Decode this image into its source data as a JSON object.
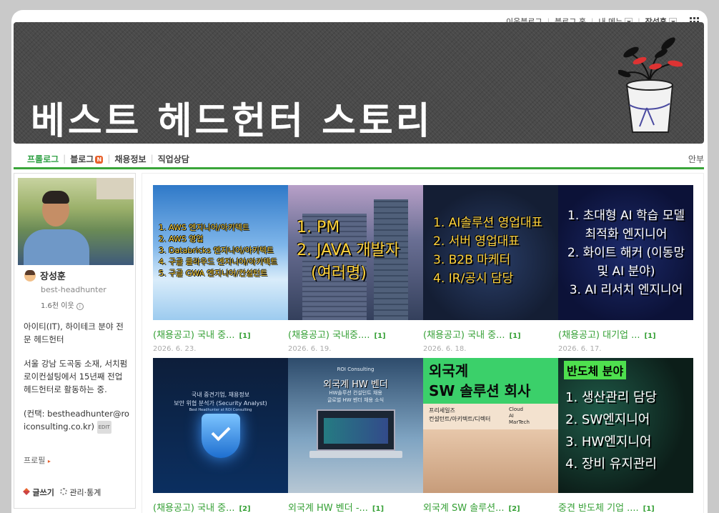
{
  "topbar": {
    "neighbors": "이웃블로그",
    "blog_home": "블로그 홈",
    "my_menu": "내 메뉴",
    "user": "장성훈"
  },
  "banner": {
    "title": "베스트 헤드헌터 스토리"
  },
  "nav": {
    "items": [
      "프롤로그",
      "블로그",
      "채용정보",
      "직업상담"
    ],
    "new_badge": "N",
    "right": "안부"
  },
  "profile": {
    "name": "장성훈",
    "id": "best-headhunter",
    "followers": "1.6천 이웃",
    "info_mark": "i",
    "bio": [
      "아이티(IT), 하이테크 분야 전문 헤드헌터",
      "서울 강남 도곡동 소재, 서치펌 로이컨설팅에서 15년째 전업 헤드헌터로 활동하는 중.",
      "(컨택: bestheadhunter@roiconsulting.co.kr)"
    ],
    "edit_tag": "EDIT",
    "profile_link": "프로필",
    "write": "글쓰기",
    "manage": "관리·통계"
  },
  "posts": [
    {
      "thumb_lines": [
        "1. AWS 엔지니어/아키텍트",
        "2. AWS 영업",
        "3. Databricks 엔지니어/아키텍트",
        "4. 구글 클라우드 엔지니어/아키텍트",
        "5. 구글 GWA 엔지니어/컨설턴트"
      ],
      "title": "(채용공고) 국내 중...",
      "count": "[1]",
      "date": "2026. 6. 23."
    },
    {
      "thumb_lines": [
        "1. PM",
        "2. JAVA 개발자",
        "(여러명)"
      ],
      "title": "(채용공고) 국내중....",
      "count": "[1]",
      "date": "2026. 6. 19."
    },
    {
      "thumb_lines": [
        "1. AI솔루션 영업대표",
        "2. 서버 영업대표",
        "3. B2B 마케터",
        "4. IR/공시 담당"
      ],
      "title": "(채용공고) 국내 중...",
      "count": "[1]",
      "date": "2026. 6. 18."
    },
    {
      "thumb_lines": [
        "1. 초대형 AI 학습 모델",
        "최적화 엔지니어",
        "2. 화이트 해커 (이동망",
        "및 AI 분야)",
        "3. AI 리서치 엔지니어"
      ],
      "title": "(채용공고) 대기업 ...",
      "count": "[1]",
      "date": "2026. 6. 17."
    },
    {
      "thumb_lines": [
        "국내 중견기업, 채용정보",
        "보안 위협 분석가 (Security Analyst)",
        "Best Headhunter at ROI Consulting"
      ],
      "title": "(채용공고) 국내 중...",
      "count": "[2]",
      "date": ""
    },
    {
      "thumb_lines": [
        "ROI Consulting",
        "외국계 HW 벤더",
        "HW솔루션 컨설턴트 채용",
        "글로벌 HW 벤더 채용 소식"
      ],
      "title": "외국계 HW 벤더 -...",
      "count": "[1]",
      "date": ""
    },
    {
      "thumb_lines": [
        "외국계",
        "SW 솔루션 회사",
        "프리세일즈",
        "컨설턴트/아키텍트/디렉터",
        "Cloud",
        "AI",
        "MarTech"
      ],
      "title": "외국계 SW 솔루션...",
      "count": "[2]",
      "date": ""
    },
    {
      "thumb_lines": [
        "반도체 분야",
        "1. 생산관리 담당",
        "2. SW엔지니어",
        "3. HW엔지니어",
        "4. 장비 유지관리"
      ],
      "title": "중견 반도체 기업 ....",
      "count": "[1]",
      "date": ""
    }
  ]
}
